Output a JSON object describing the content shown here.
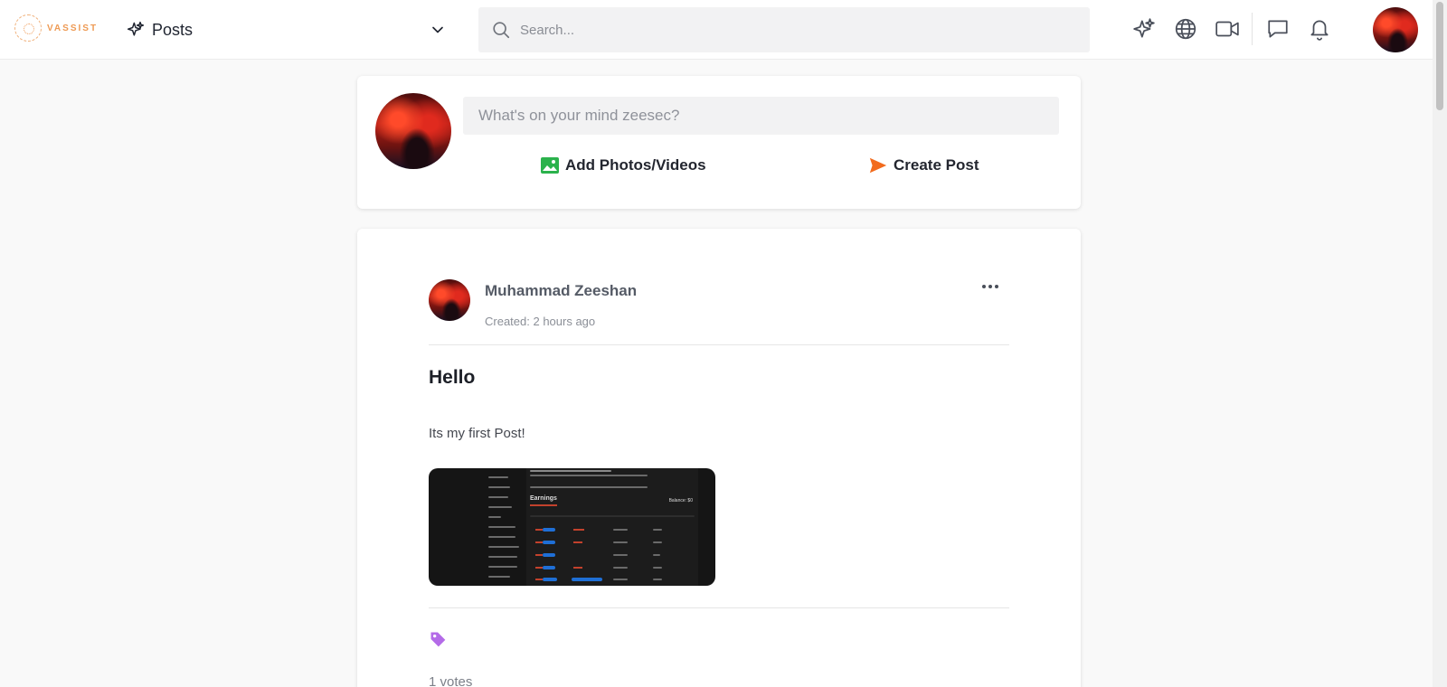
{
  "header": {
    "logo_text": "VASSIST",
    "section_label": "Posts",
    "search_placeholder": "Search...",
    "icons": [
      "sparkles-icon",
      "globe-icon",
      "video-icon",
      "chat-icon",
      "bell-icon"
    ]
  },
  "composer": {
    "placeholder": "What's on your mind zeesec?",
    "add_media_label": "Add Photos/Videos",
    "create_post_label": "Create Post"
  },
  "post": {
    "author": "Muhammad Zeeshan",
    "created": "Created: 2 hours ago",
    "title": "Hello",
    "body": "Its my first Post!",
    "votes": "1 votes",
    "attachment": {
      "heading": "Earnings",
      "balance": "Balance: $0"
    }
  },
  "colors": {
    "accent_orange": "#f26b1d",
    "media_green": "#2bb24c",
    "tag_purple": "#b46be8"
  }
}
